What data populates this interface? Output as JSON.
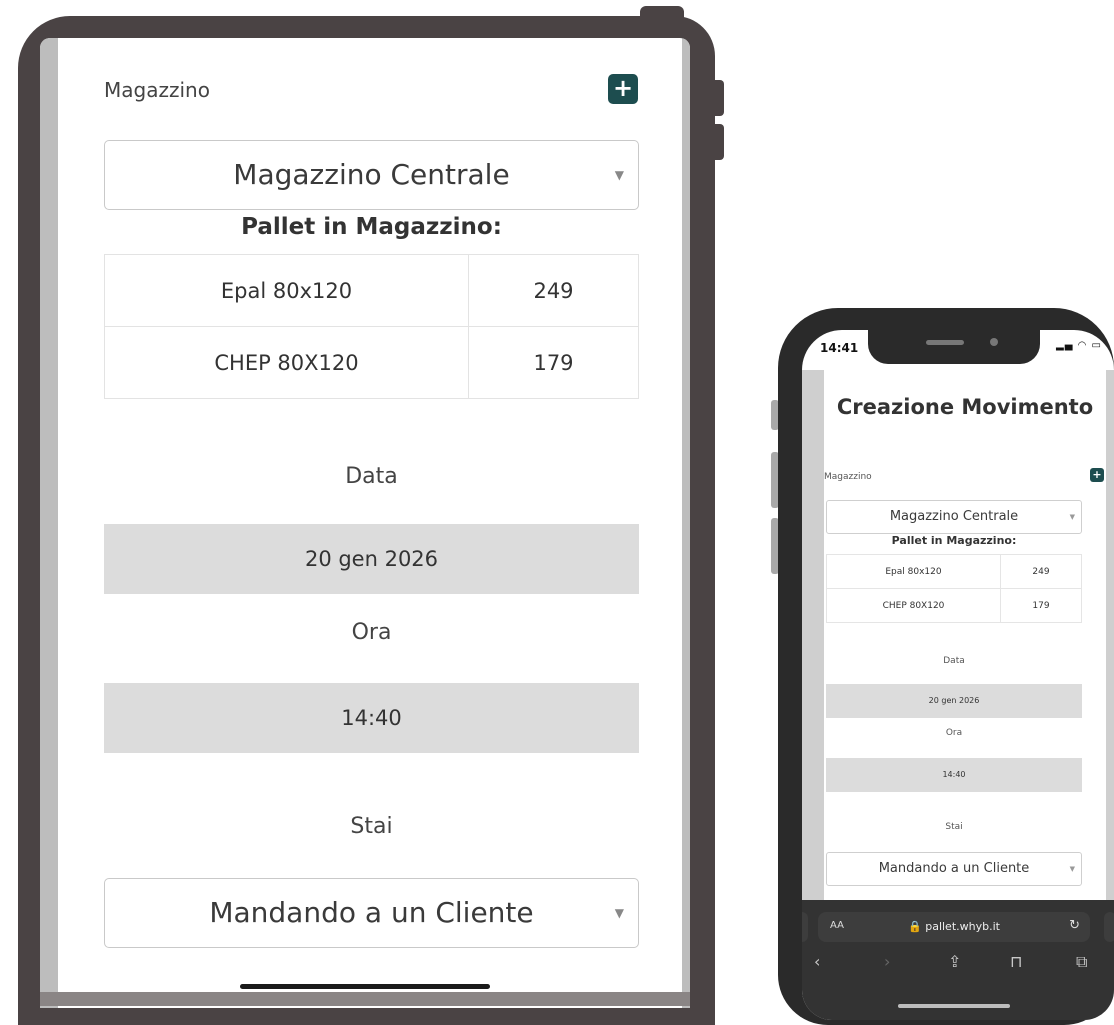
{
  "tablet": {
    "warehouse_label": "Magazzino",
    "add_icon": "plus-icon",
    "warehouse_select": "Magazzino Centrale",
    "pallets_heading": "Pallet in Magazzino:",
    "pallets": [
      {
        "name": "Epal 80x120",
        "count": "249"
      },
      {
        "name": "CHEP 80X120",
        "count": "179"
      }
    ],
    "date_label": "Data",
    "date_value": "20 gen 2026",
    "time_label": "Ora",
    "time_value": "14:40",
    "status_label": "Stai",
    "status_select": "Mandando a un Cliente"
  },
  "phone": {
    "status_time": "14:41",
    "status_icons": "signal-wifi-battery",
    "page_title": "Creazione Movimento",
    "warehouse_label": "Magazzino",
    "warehouse_select": "Magazzino Centrale",
    "pallets_heading": "Pallet in Magazzino:",
    "pallets": [
      {
        "name": "Epal 80x120",
        "count": "249"
      },
      {
        "name": "CHEP 80X120",
        "count": "179"
      }
    ],
    "date_label": "Data",
    "date_value": "20 gen 2026",
    "time_label": "Ora",
    "time_value": "14:40",
    "status_label": "Stai",
    "status_select": "Mandando a un Cliente",
    "browser": {
      "text_size": "AA",
      "url": "pallet.whyb.it"
    }
  },
  "colors": {
    "accent": "#1d4d4f",
    "field_bg": "#dcdcdc",
    "device_frame": "#4a4344"
  }
}
